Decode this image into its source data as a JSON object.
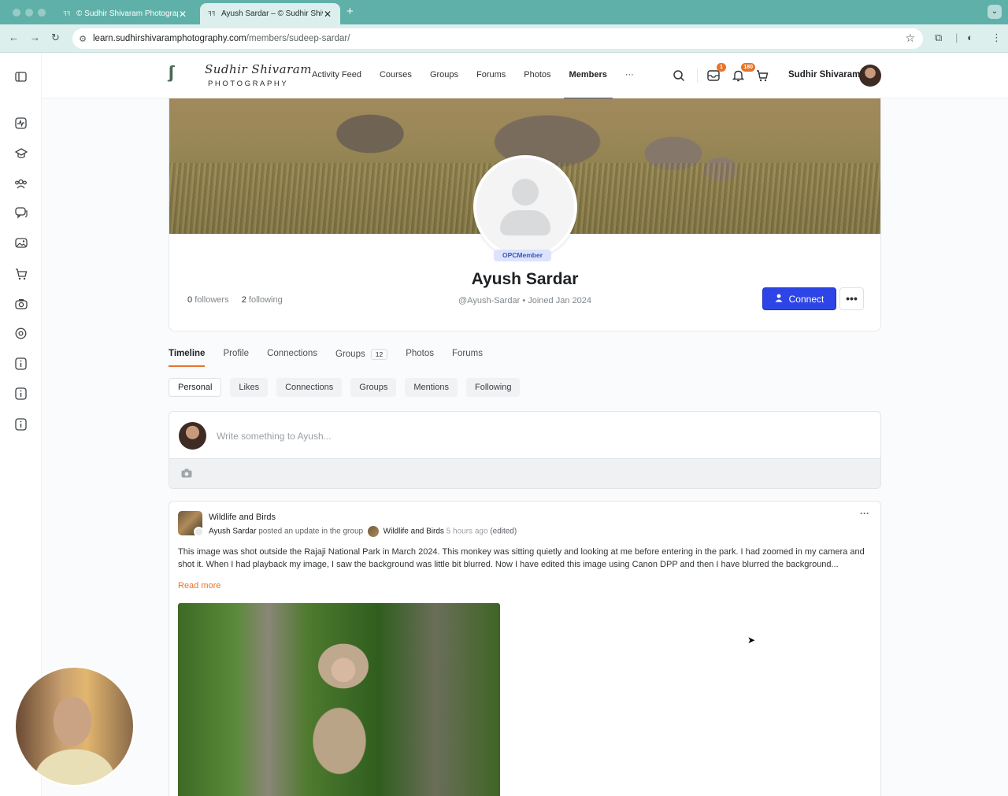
{
  "browser": {
    "tabs": [
      {
        "title": "© Sudhir Shivaram Photography",
        "active": false
      },
      {
        "title": "Ayush Sardar – © Sudhir Shivaram Photography",
        "active": true
      }
    ],
    "url_host": "learn.sudhirshivaramphotography.com",
    "url_path": "/members/sudeep-sardar/"
  },
  "site": {
    "logo_script": "Sudhir Shivaram",
    "logo_sub": "PHOTOGRAPHY",
    "menu": [
      {
        "label": "Activity Feed",
        "active": false
      },
      {
        "label": "Courses",
        "active": false
      },
      {
        "label": "Groups",
        "active": false
      },
      {
        "label": "Forums",
        "active": false
      },
      {
        "label": "Photos",
        "active": false
      },
      {
        "label": "Members",
        "active": true
      },
      {
        "label": "···",
        "active": false
      }
    ],
    "messages_badge": "1",
    "notifications_badge": "180",
    "user_name": "Sudhir Shivaram"
  },
  "sidebar_icons": [
    "panel-toggle-icon",
    "activity-icon",
    "courses-icon",
    "groups-icon",
    "forums-icon",
    "photos-icon",
    "cart-icon",
    "camera-icon",
    "mention-icon",
    "info-icon",
    "info-icon",
    "info-icon"
  ],
  "profile": {
    "role": "OPCMember",
    "name": "Ayush Sardar",
    "handle": "@Ayush-Sardar",
    "joined": "Joined Jan 2024",
    "followers_count": "0",
    "followers_label": "followers",
    "following_count": "2",
    "following_label": "following",
    "connect_label": "Connect",
    "more_label": "•••"
  },
  "tabs": [
    {
      "label": "Timeline",
      "active": true
    },
    {
      "label": "Profile"
    },
    {
      "label": "Connections"
    },
    {
      "label": "Groups",
      "count": "12"
    },
    {
      "label": "Photos"
    },
    {
      "label": "Forums"
    }
  ],
  "subtabs": [
    {
      "label": "Personal",
      "active": true
    },
    {
      "label": "Likes"
    },
    {
      "label": "Connections"
    },
    {
      "label": "Groups"
    },
    {
      "label": "Mentions"
    },
    {
      "label": "Following"
    }
  ],
  "composer": {
    "placeholder": "Write something to Ayush..."
  },
  "post": {
    "group_name": "Wildlife and Birds",
    "author": "Ayush Sardar",
    "action": "posted an update in the group",
    "group_ref": "Wildlife and Birds",
    "time_ago": "5 hours ago",
    "edited": "(edited)",
    "text": "This image was shot outside the Rajaji National Park in March 2024. This monkey was sitting quietly and looking at me before entering in the park. I had zoomed in my camera and shot it. When I had playback my image, I saw the background was little bit blurred. Now I have edited this image using Canon DPP and then I have blurred the background...",
    "read_more": "Read more",
    "menu_label": "···"
  },
  "colors": {
    "accent_orange": "#e8742b",
    "connect_blue": "#2d44e6",
    "browser_teal": "#5fb0a8"
  }
}
